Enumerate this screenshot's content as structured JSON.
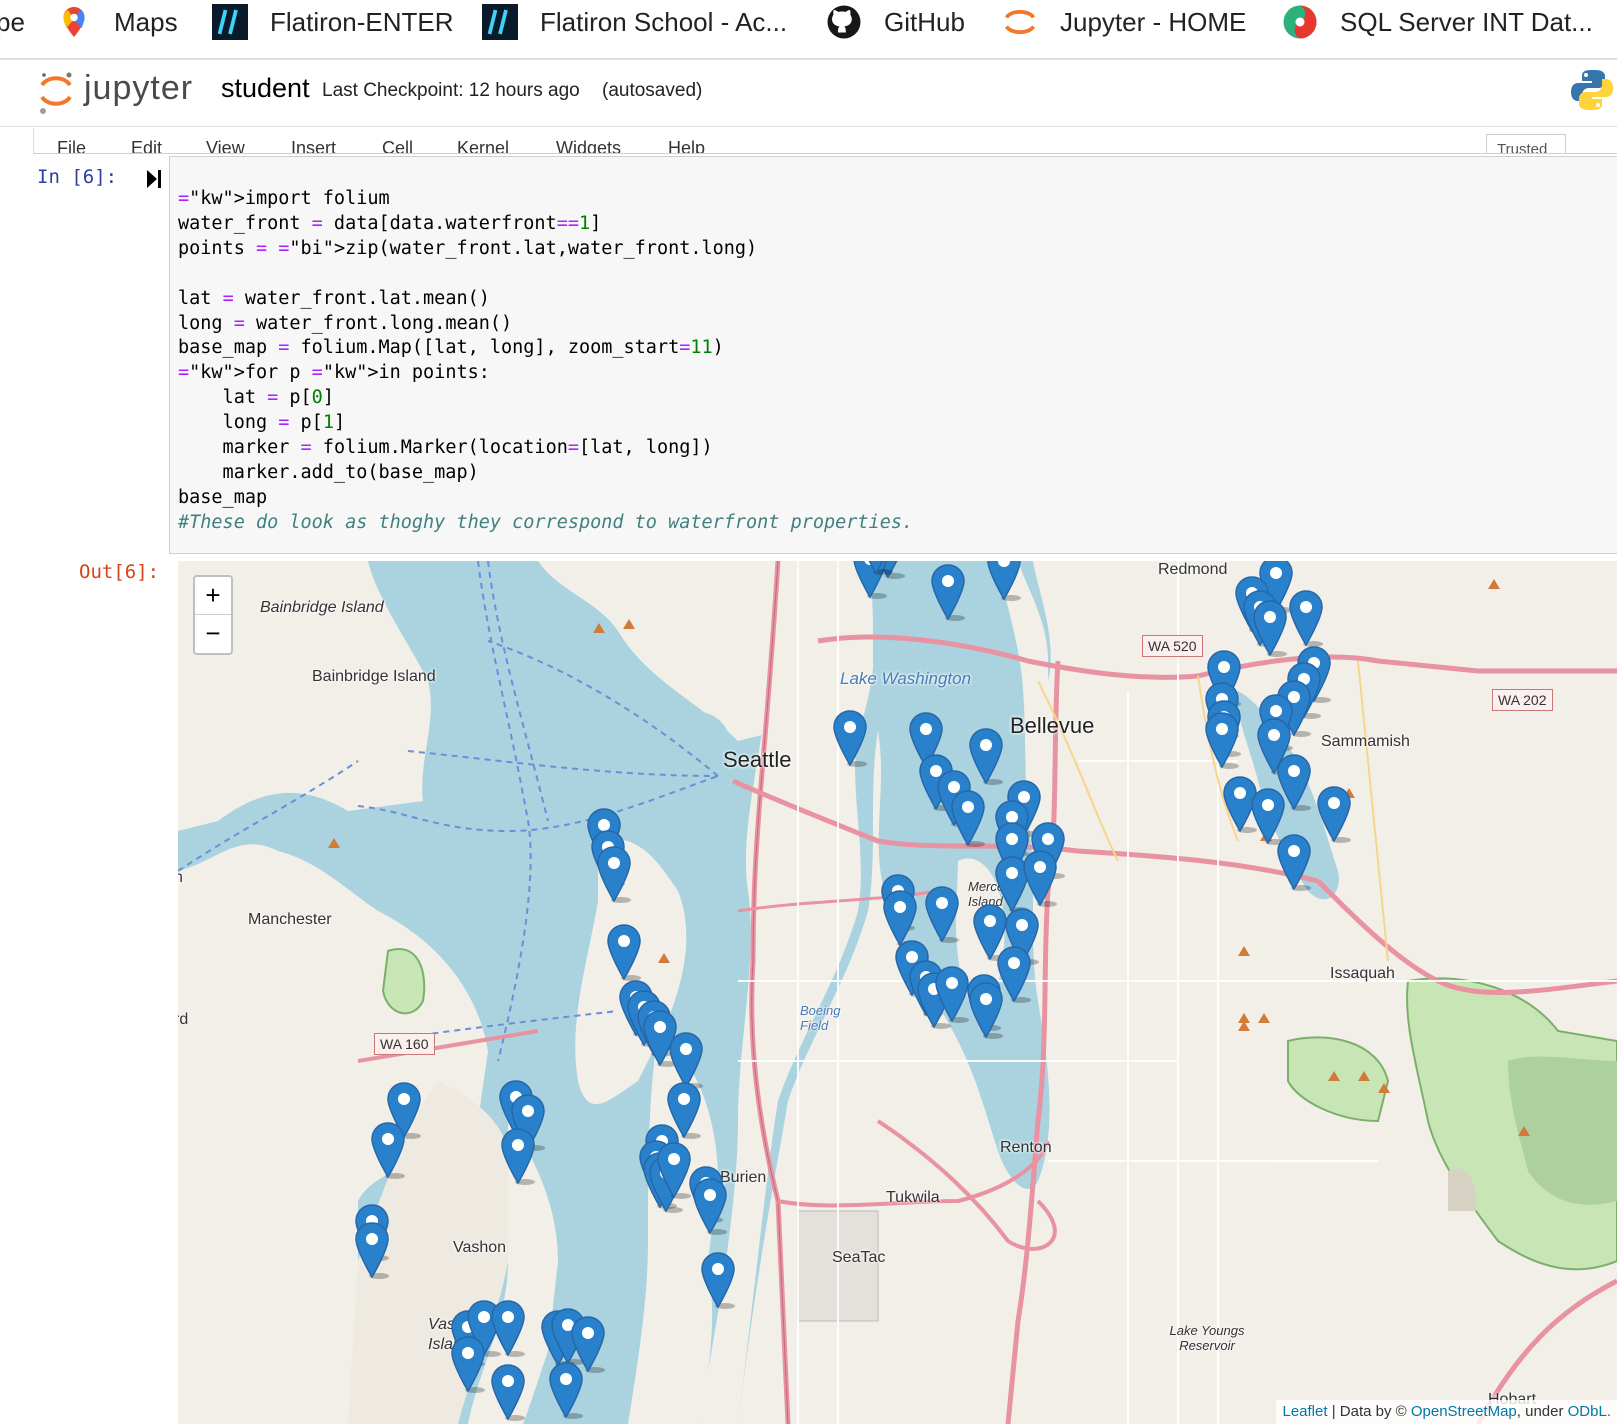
{
  "bookmarks": [
    {
      "label": "pe",
      "icon": "truncated-icon"
    },
    {
      "label": "Maps",
      "icon": "google-maps-icon"
    },
    {
      "label": "Flatiron-ENTER",
      "icon": "flatiron-icon"
    },
    {
      "label": "Flatiron School - Ac...",
      "icon": "flatiron-icon"
    },
    {
      "label": "GitHub",
      "icon": "github-icon"
    },
    {
      "label": "Jupyter - HOME",
      "icon": "jupyter-icon"
    },
    {
      "label": "SQL Server INT Dat...",
      "icon": "sql-icon"
    }
  ],
  "header": {
    "logo_text": "jupyter",
    "notebook_name": "student",
    "checkpoint": "Last Checkpoint: 12 hours ago",
    "autosaved": "(autosaved)"
  },
  "menubar": {
    "items": [
      "File",
      "Edit",
      "View",
      "Insert",
      "Cell",
      "Kernel",
      "Widgets",
      "Help"
    ],
    "trusted": "Trusted"
  },
  "cell": {
    "in_prompt": "In [6]:",
    "out_prompt": "Out[6]:",
    "code_lines": [
      "import folium",
      "water_front = data[data.waterfront==1]",
      "points = zip(water_front.lat,water_front.long)",
      "",
      "lat = water_front.lat.mean()",
      "long = water_front.long.mean()",
      "base_map = folium.Map([lat, long], zoom_start=11)",
      "for p in points:",
      "    lat = p[0]",
      "    long = p[1]",
      "    marker = folium.Marker(location=[lat, long])",
      "    marker.add_to(base_map)",
      "base_map",
      "#These do look as thoghy they correspond to waterfront properties."
    ]
  },
  "map": {
    "zoom_in": "+",
    "zoom_out": "−",
    "marker_color": "#2a81cb",
    "water_color": "#aad3df",
    "land_color": "#f2efe9",
    "attribution": {
      "leaflet": "Leaflet",
      "data_by": " | Data by © ",
      "osm": "OpenStreetMap",
      "under": ", under ",
      "odbl": "ODbL."
    },
    "labels": {
      "bainbridge_island_water": "Bainbridge Island",
      "bainbridge_island": "Bainbridge Island",
      "seattle": "Seattle",
      "bellevue": "Bellevue",
      "redmond": "Redmond",
      "sammamish": "Sammamish",
      "issaquah": "Issaquah",
      "renton": "Renton",
      "tukwila": "Tukwila",
      "seatac": "SeaTac",
      "burien": "Burien",
      "vashon": "Vashon",
      "vashon_island": "Vashon Island",
      "manchester": "Manchester",
      "lake_washington": "Lake Washington",
      "boeing_field": "Boeing Field",
      "mercer_island": "Mercer Island",
      "lake_youngs": "Lake Youngs Reservoir",
      "hobart": "Hobart",
      "wa520": "WA 520",
      "wa202": "WA 202",
      "wa160": "WA 160",
      "edge_n": "n",
      "edge_rd": "rd"
    }
  }
}
